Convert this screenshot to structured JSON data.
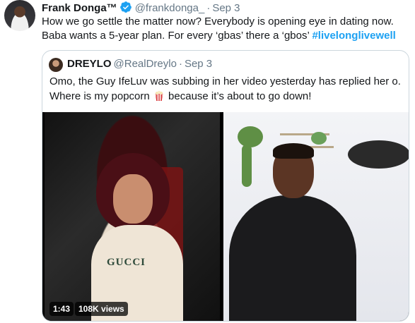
{
  "tweet": {
    "author_name": "Frank Donga™",
    "author_handle": "@frankdonga_",
    "separator": "·",
    "time": "Sep 3",
    "text_line1": "How we go settle the matter now? Everybody is opening eye in dating now.",
    "text_line2": "Baba wants a 5-year plan. For every ‘gbas’ there a ‘gbos’ ",
    "hashtag": "#livelonglivewell",
    "avatar_icon": "profile-avatar",
    "verified_icon": "verified-badge-icon",
    "verified_color": "#1da1f2"
  },
  "quoted": {
    "author_name": "DREYLO",
    "author_handle": "@RealDreylo",
    "separator": "·",
    "time": "Sep 3",
    "text_part1": "Omo, the Guy IfeLuv was subbing in her video yesterday has replied her o. Where is my popcorn",
    "emoji_icon": "popcorn-icon",
    "text_part2": " because it’s about to go down!",
    "video": {
      "duration": "1:43",
      "views": "108K views",
      "shirt_print": "GUCCI"
    }
  },
  "colors": {
    "link": "#1da1f2",
    "muted": "#657786",
    "border": "#ccd6dd",
    "text": "#14171a"
  }
}
